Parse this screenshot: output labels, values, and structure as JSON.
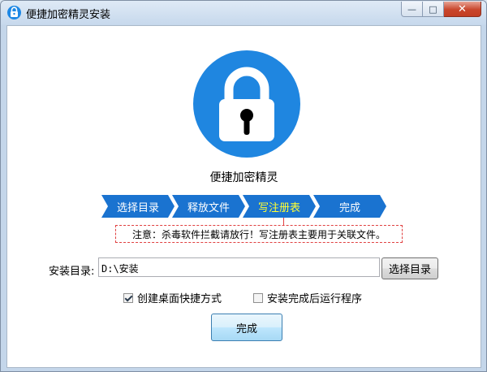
{
  "window": {
    "title": "便捷加密精灵安装",
    "controls": {
      "min": "—",
      "max": "□",
      "close": "✕"
    }
  },
  "app": {
    "name": "便捷加密精灵",
    "logo_icon": "padlock-icon",
    "accent": "#1f86e0"
  },
  "steps": [
    {
      "label": "选择目录",
      "active": false
    },
    {
      "label": "释放文件",
      "active": false
    },
    {
      "label": "写注册表",
      "active": true
    },
    {
      "label": "完成",
      "active": false
    }
  ],
  "notice": "注意：杀毒软件拦截请放行！写注册表主要用于关联文件。",
  "install_dir": {
    "label": "安装目录:",
    "value": "D:\\安装",
    "browse_label": "选择目录"
  },
  "options": {
    "desktop_shortcut": {
      "label": "创建桌面快捷方式",
      "checked": true
    },
    "run_after_install": {
      "label": "安装完成后运行程序",
      "checked": false
    }
  },
  "finish_label": "完成"
}
